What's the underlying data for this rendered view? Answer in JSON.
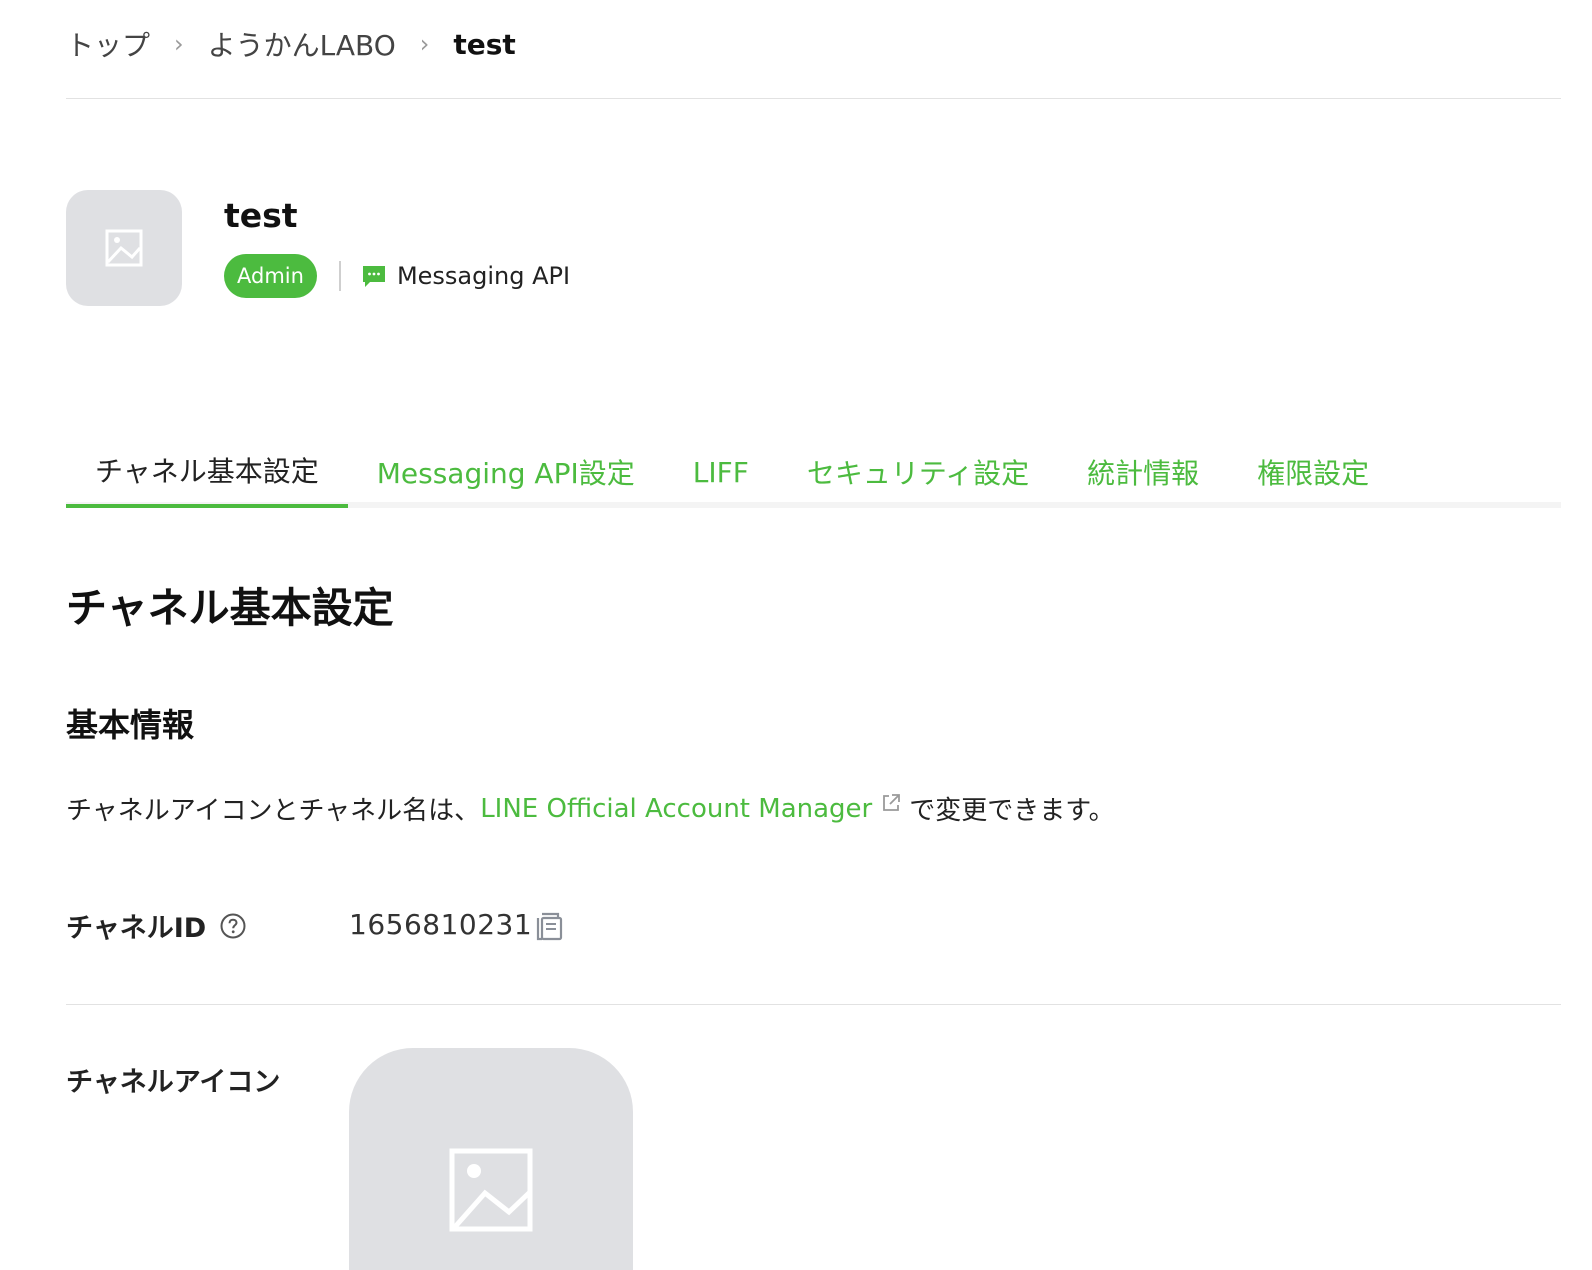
{
  "breadcrumb": {
    "items": [
      "トップ",
      "ようかんLABO"
    ],
    "current": "test",
    "separator": "›"
  },
  "channel": {
    "name": "test",
    "role_badge": "Admin",
    "type": "Messaging API"
  },
  "tabs": [
    {
      "label": "チャネル基本設定",
      "active": true
    },
    {
      "label": "Messaging API設定",
      "active": false
    },
    {
      "label": "LIFF",
      "active": false
    },
    {
      "label": "セキュリティ設定",
      "active": false
    },
    {
      "label": "統計情報",
      "active": false
    },
    {
      "label": "権限設定",
      "active": false
    }
  ],
  "section": {
    "title": "チャネル基本設定",
    "subtitle": "基本情報",
    "info_prefix": "チャネルアイコンとチャネル名は、",
    "info_link": "LINE Official Account Manager",
    "info_suffix": "で変更できます。"
  },
  "fields": {
    "channel_id_label": "チャネルID",
    "channel_id_value": "1656810231",
    "channel_icon_label": "チャネルアイコン"
  },
  "colors": {
    "accent": "#4cbb3f",
    "placeholder_bg": "#dfe0e3"
  },
  "icons": {
    "avatar": "image-placeholder-icon",
    "messaging": "chat-bubble-icon",
    "external": "external-link-icon",
    "help": "question-circle-icon",
    "copy": "copy-icon"
  }
}
